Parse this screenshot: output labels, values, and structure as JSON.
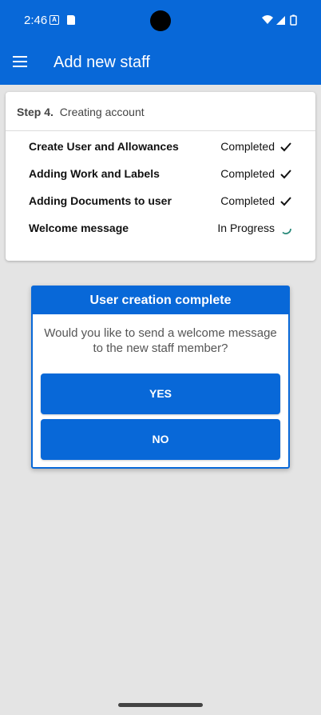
{
  "status_bar": {
    "time": "2:46",
    "icons": [
      "a-icon",
      "sd-card-icon",
      "wifi-icon",
      "signal-icon",
      "battery-icon"
    ]
  },
  "app_bar": {
    "title": "Add new staff",
    "menu_icon": "hamburger-menu-icon"
  },
  "step_card": {
    "step_label": "Step 4.",
    "step_title": "Creating account",
    "rows": [
      {
        "label": "Create User and Allowances",
        "status": "Completed",
        "icon": "check-icon"
      },
      {
        "label": "Adding Work and Labels",
        "status": "Completed",
        "icon": "check-icon"
      },
      {
        "label": "Adding Documents to user",
        "status": "Completed",
        "icon": "check-icon"
      },
      {
        "label": "Welcome message",
        "status": "In Progress",
        "icon": "spinner-icon"
      }
    ]
  },
  "dialog": {
    "title": "User creation complete",
    "message": "Would you like to send a welcome message to the new staff member?",
    "yes_label": "YES",
    "no_label": "NO"
  },
  "colors": {
    "primary": "#0868d8",
    "background": "#e4e4e4",
    "spinner": "#2a8a7a"
  }
}
